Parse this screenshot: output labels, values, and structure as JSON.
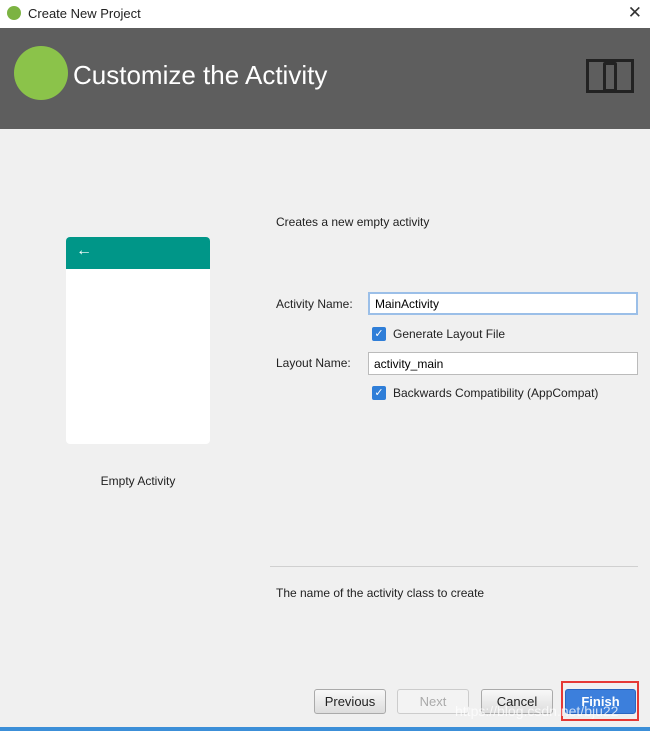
{
  "window": {
    "title": "Create New Project",
    "close": "✕"
  },
  "header": {
    "title": "Customize the Activity"
  },
  "template": {
    "name": "Empty Activity",
    "back_arrow": "←"
  },
  "form": {
    "description": "Creates a new empty activity",
    "activity_name_label": "Activity Name:",
    "activity_name_value": "MainActivity",
    "generate_layout_label": "Generate Layout File",
    "generate_layout_checked": true,
    "layout_name_label": "Layout Name:",
    "layout_name_value": "activity_main",
    "backwards_label": "Backwards Compatibility (AppCompat)",
    "backwards_checked": true,
    "hint": "The name of the activity class to create"
  },
  "buttons": {
    "previous": "Previous",
    "next": "Next",
    "cancel": "Cancel",
    "finish": "Finish"
  },
  "watermark": "https://blog.csdn.net/bju22"
}
